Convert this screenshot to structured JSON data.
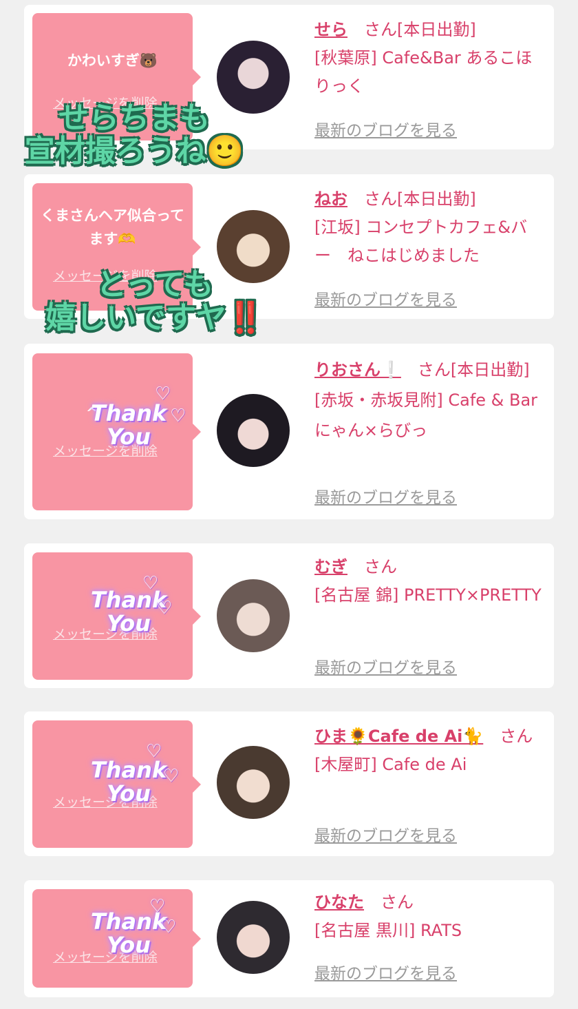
{
  "cards": [
    {
      "message": "かわいすぎ🐻",
      "delete_label": "メッセージを削除",
      "name": "せら",
      "san": "さん",
      "status": "[本日出勤]",
      "shop": "[秋葉原] Cafe&Bar あるこほりっく",
      "blog": "最新のブログを見る"
    },
    {
      "message": "くまさんヘア似合ってます🫶",
      "delete_label": "メッセージを削除",
      "name": "ねお",
      "san": "さん",
      "status": "[本日出勤]",
      "shop": "[江坂] コンセプトカフェ&バー　ねこはじめました",
      "blog": "最新のブログを見る"
    },
    {
      "message": "^",
      "delete_label": "メッセージを削除",
      "name": "りおさん❕",
      "san": "さん",
      "status": "[本日出勤]",
      "shop": "[赤坂・赤坂見附] Cafe & Bar にゃん×らびっ",
      "blog": "最新のブログを見る"
    },
    {
      "message": "",
      "delete_label": "メッセージを削除",
      "name": "むぎ",
      "san": "さん",
      "status": "",
      "shop": "[名古屋 錦] PRETTY×PRETTY",
      "blog": "最新のブログを見る"
    },
    {
      "message": "",
      "delete_label": "メッセージを削除",
      "name": "ひま🌻Cafe de Ai🐈",
      "san": "さん",
      "status": "",
      "shop": "[木屋町] Cafe de Ai",
      "blog": "最新のブログを見る"
    },
    {
      "message": "",
      "delete_label": "メッセージを削除",
      "name": "ひなた",
      "san": "さん",
      "status": "",
      "shop": "[名古屋 黒川] RATS",
      "blog": "最新のブログを見る"
    }
  ],
  "stickers": {
    "thank": "Thank",
    "you": "You",
    "overlay1_line1": "せらちまも",
    "overlay1_line2": "宣材撮ろうね🙂",
    "overlay2_line1": "とっても",
    "overlay2_line2": "嬉しいですヤ",
    "overlay2_bang": "‼️"
  },
  "colors": {
    "bubble": "#f895a3",
    "name": "#d8406a",
    "background": "#f0f0f0"
  }
}
